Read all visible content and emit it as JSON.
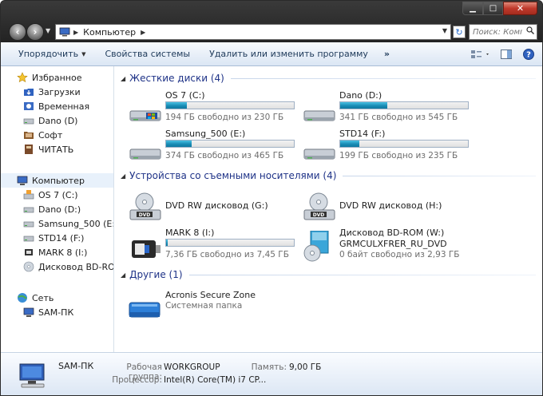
{
  "window": {
    "minimize": "▁",
    "maximize": "□",
    "close": "✕"
  },
  "address": {
    "path": "Компьютер",
    "search_placeholder": "Поиск: Комп..."
  },
  "toolbar": {
    "organize": "Упорядочить",
    "system_props": "Свойства системы",
    "uninstall": "Удалить или изменить программу",
    "more": "»"
  },
  "sidebar": {
    "favorites": {
      "label": "Избранное",
      "items": [
        {
          "label": "Загрузки",
          "icon": "downloads-folder-icon"
        },
        {
          "label": "Временная",
          "icon": "recent-icon"
        },
        {
          "label": "Dano (D)",
          "icon": "drive-icon"
        },
        {
          "label": "Софт",
          "icon": "folder-icon"
        },
        {
          "label": "ЧИТАТЬ",
          "icon": "book-icon"
        }
      ]
    },
    "computer": {
      "label": "Компьютер",
      "items": [
        {
          "label": "OS 7 (C:)",
          "icon": "system-drive-icon"
        },
        {
          "label": "Dano (D:)",
          "icon": "drive-icon"
        },
        {
          "label": "Samsung_500 (E:)",
          "icon": "drive-icon"
        },
        {
          "label": "STD14 (F:)",
          "icon": "drive-icon"
        },
        {
          "label": "MARK 8 (I:)",
          "icon": "usb-drive-icon"
        },
        {
          "label": "Дисковод BD-ROM (",
          "icon": "disc-icon"
        }
      ]
    },
    "network": {
      "label": "Сеть",
      "items": [
        {
          "label": "SAM-ПК",
          "icon": "computer-icon"
        }
      ]
    }
  },
  "groups": {
    "hdd": {
      "title": "Жесткие диски (4)",
      "drives": [
        {
          "name": "OS 7 (C:)",
          "free": "194 ГБ свободно из 230 ГБ",
          "used_fraction": 0.16
        },
        {
          "name": "Dano (D:)",
          "free": "341 ГБ свободно из 545 ГБ",
          "used_fraction": 0.37
        },
        {
          "name": "Samsung_500 (E:)",
          "free": "374 ГБ свободно из 465 ГБ",
          "used_fraction": 0.2
        },
        {
          "name": "STD14 (F:)",
          "free": "199 ГБ свободно из 235 ГБ",
          "used_fraction": 0.15
        }
      ]
    },
    "removable": {
      "title": "Устройства со съемными носителями (4)",
      "devices": [
        {
          "name": "DVD RW дисковод (G:)"
        },
        {
          "name": "DVD RW дисковод (H:)"
        },
        {
          "name": "MARK 8 (I:)",
          "free": "7,36 ГБ свободно из 7,45 ГБ",
          "used_fraction": 0.01
        },
        {
          "name": "Дисковод BD-ROM (W:)",
          "line2": "GRMCULXFRER_RU_DVD",
          "free": "0 байт свободно из 2,93 ГБ"
        }
      ]
    },
    "other": {
      "title": "Другие (1)",
      "items": [
        {
          "name": "Acronis Secure Zone",
          "sub": "Системная папка"
        }
      ]
    }
  },
  "details": {
    "name": "SAM-ПК",
    "workgroup_label": "Рабочая группа:",
    "workgroup": "WORKGROUP",
    "memory_label": "Память:",
    "memory": "9,00 ГБ",
    "cpu_label": "Процессор:",
    "cpu": "Intel(R) Core(TM) i7 CP..."
  }
}
